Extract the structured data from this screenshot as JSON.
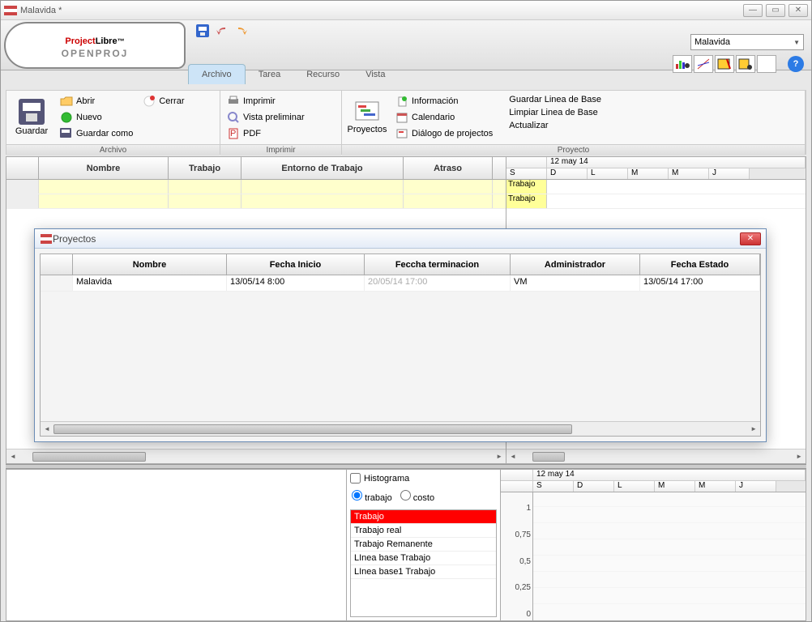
{
  "window": {
    "title": "Malavida *"
  },
  "logo": {
    "brand_a": "Project",
    "brand_b": "Libre",
    "tm": "™",
    "sub": "OPENPROJ"
  },
  "project_selector": {
    "value": "Malavida"
  },
  "tabs": {
    "archivo": "Archivo",
    "tarea": "Tarea",
    "recurso": "Recurso",
    "vista": "Vista"
  },
  "ribbon": {
    "archivo": {
      "label": "Archivo",
      "guardar": "Guardar",
      "abrir": "Abrir",
      "nuevo": "Nuevo",
      "guardar_como": "Guardar como",
      "cerrar": "Cerrar"
    },
    "imprimir": {
      "label": "Imprimir",
      "imprimir": "Imprimir",
      "vista_preliminar": "Vista preliminar",
      "pdf": "PDF"
    },
    "proyecto": {
      "label": "Proyecto",
      "proyectos": "Proyectos",
      "informacion": "Información",
      "calendario": "Calendario",
      "dialogo": "Diálogo de projectos",
      "guardar_linea": "Guardar Linea de Base",
      "limpiar_linea": "Limpiar Linea de Base",
      "actualizar": "Actualizar"
    }
  },
  "grid": {
    "cols": {
      "nombre": "Nombre",
      "trabajo": "Trabajo",
      "entorno": "Entorno de Trabajo",
      "atraso": "Atraso"
    }
  },
  "gantt": {
    "date": "12 may 14",
    "days": [
      "S",
      "D",
      "L",
      "M",
      "M",
      "J"
    ],
    "row1": "Trabajo",
    "row2": "Trabajo"
  },
  "dialog": {
    "title": "Proyectos",
    "cols": {
      "nombre": "Nombre",
      "inicio": "Fecha Inicio",
      "terminacion": "Feccha terminacion",
      "admin": "Administrador",
      "estado": "Fecha Estado"
    },
    "row": {
      "nombre": "Malavida",
      "inicio": "13/05/14 8:00",
      "terminacion": "20/05/14 17:00",
      "admin": "VM",
      "estado": "13/05/14 17:00"
    }
  },
  "lower": {
    "histograma": "Histograma",
    "trabajo": "trabajo",
    "costo": "costo",
    "list": {
      "i0": "Trabajo",
      "i1": "Trabajo real",
      "i2": "Trabajo Remanente",
      "i3": "LInea base Trabajo",
      "i4": "LInea base1 Trabajo"
    },
    "date": "12 may 14",
    "days": [
      "S",
      "D",
      "L",
      "M",
      "M",
      "J"
    ],
    "yticks": {
      "t1": "1",
      "t075": "0,75",
      "t05": "0,5",
      "t025": "0,25",
      "t0": "0"
    }
  },
  "help": "?"
}
